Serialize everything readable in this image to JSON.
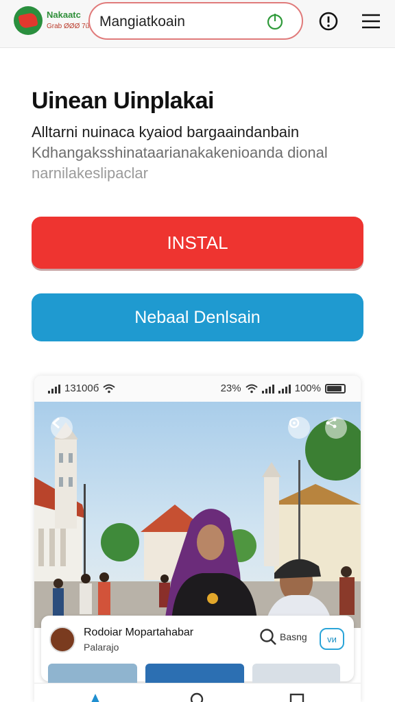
{
  "header": {
    "brand_name": "Nakaatc",
    "brand_sub": "Grab ØØØ 7ű",
    "search_text": "Mangiatkoain"
  },
  "main": {
    "title": "Uinean Uinplakai",
    "desc_line1": "Alltarni nuinaca kyaiod bargaaindanbain",
    "desc_line2": "Kdhangaksshinataarianakakenioanda dional",
    "desc_line3": "narnilakeslipaclar",
    "install_label": "INSTAL",
    "open_label": "Nebaal Denlsain"
  },
  "preview": {
    "status_time": "13100б",
    "status_mid": "23%",
    "status_batt": "100%",
    "card_title": "Rodoiar Mopartahabar",
    "card_sub": "Palarajo",
    "card_search": "Basng",
    "card_btn": "ᴠᴎ"
  },
  "colors": {
    "install": "#ee3430",
    "open": "#1f9ad0",
    "brand_green": "#2f8f3a",
    "search_border": "#e07a7a"
  }
}
